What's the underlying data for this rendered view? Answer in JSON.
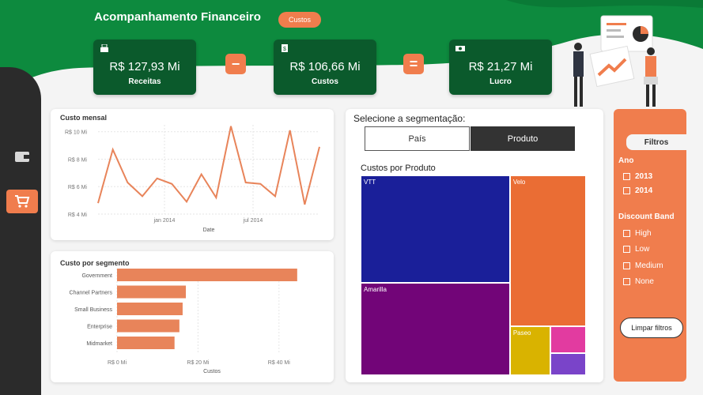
{
  "header": {
    "title": "Acompanhamento Financeiro",
    "badge": "Custos"
  },
  "kpis": [
    {
      "value": "R$ 127,93 Mi",
      "label": "Receitas",
      "icon": "register-icon"
    },
    {
      "value": "R$ 106,66 Mi",
      "label": "Custos",
      "icon": "document-dollar-icon"
    },
    {
      "value": "R$ 21,27 Mi",
      "label": "Lucro",
      "icon": "banknote-icon"
    }
  ],
  "operators": {
    "minus": "−",
    "equals": "="
  },
  "sidebar": {
    "items": [
      {
        "name": "wallet-icon"
      },
      {
        "name": "cart-icon",
        "active": true
      }
    ]
  },
  "segmentation": {
    "label": "Selecione a segmentação:",
    "options": [
      "País",
      "Produto"
    ],
    "selected": "Produto"
  },
  "filters": {
    "title": "Filtros",
    "year_label": "Ano",
    "years": [
      "2013",
      "2014"
    ],
    "band_label": "Discount Band",
    "bands": [
      "High",
      "Low",
      "Medium",
      "None"
    ],
    "clear_label": "Limpar filtros"
  },
  "chart_data": [
    {
      "type": "line",
      "title": "Custo mensal",
      "xlabel": "Date",
      "ylabel": "",
      "y_ticks": [
        "R$ 4 Mi",
        "R$ 6 Mi",
        "R$ 8 Mi",
        "R$ 10 Mi"
      ],
      "x_ticks": [
        "jan 2014",
        "jul 2014"
      ],
      "ylim": [
        4,
        10.5
      ],
      "values": [
        4.8,
        8.7,
        6.3,
        5.3,
        6.6,
        6.2,
        4.9,
        6.9,
        5.2,
        10.4,
        6.3,
        6.2,
        5.3,
        10.1,
        4.7,
        8.9
      ],
      "color": "#e8845a"
    },
    {
      "type": "bar",
      "title": "Custo por segmento",
      "xlabel": "Custos",
      "ylabel": "",
      "categories": [
        "Government",
        "Channel Partners",
        "Small Business",
        "Enterprise",
        "Midmarket"
      ],
      "values": [
        44.5,
        17,
        16.2,
        15.4,
        14.2
      ],
      "x_ticks": [
        "R$ 0 Mi",
        "R$ 20 Mi",
        "R$ 40 Mi"
      ],
      "xlim": [
        0,
        50
      ],
      "color": "#e8845a"
    },
    {
      "type": "heatmap",
      "title": "Custos por Produto",
      "categories": [
        "VTT",
        "Velo",
        "Amarilla",
        "Paseo",
        "",
        ""
      ],
      "values": [
        28.8,
        20.5,
        24.6,
        3.6,
        1.7,
        1.4
      ],
      "colors": [
        "#1a1f99",
        "#ea6d34",
        "#720578",
        "#d9b300",
        "#e23ba0",
        "#7a44c9"
      ]
    }
  ]
}
